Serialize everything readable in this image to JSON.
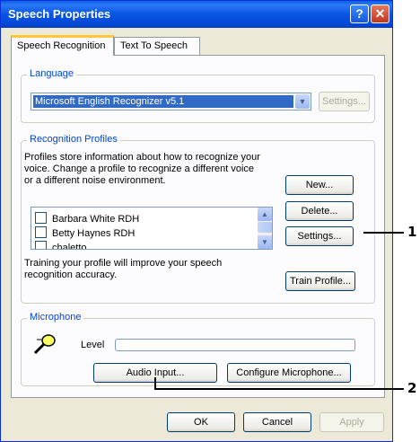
{
  "window": {
    "title": "Speech Properties",
    "help_glyph": "?",
    "close_glyph": "✕"
  },
  "tabs": [
    {
      "label": "Speech Recognition",
      "active": true
    },
    {
      "label": "Text To Speech",
      "active": false
    }
  ],
  "language": {
    "group_label": "Language",
    "selected_engine": "Microsoft English Recognizer v5.1",
    "settings_label": "Settings..."
  },
  "profiles": {
    "group_label": "Recognition Profiles",
    "description": [
      "Profiles store information about how to recognize your",
      "voice.  Change a profile to recognize a different voice",
      "or a different noise environment."
    ],
    "items": [
      {
        "label": "Barbara White RDH",
        "checked": false
      },
      {
        "label": "Betty Haynes RDH",
        "checked": false
      },
      {
        "label": "chaletto",
        "checked": false
      }
    ],
    "new_label": "New...",
    "delete_label": "Delete...",
    "settings_label": "Settings...",
    "training_text": [
      "Training your profile will improve your speech",
      "recognition accuracy."
    ],
    "train_label": "Train Profile..."
  },
  "microphone": {
    "group_label": "Microphone",
    "level_label": "Level",
    "audio_input_label": "Audio Input...",
    "configure_label": "Configure Microphone..."
  },
  "footer": {
    "ok_label": "OK",
    "cancel_label": "Cancel",
    "apply_label": "Apply"
  },
  "callouts": [
    {
      "number": "1"
    },
    {
      "number": "2"
    }
  ],
  "colors": {
    "titlebar": "#0755e3",
    "group_label": "#0046d5",
    "selection": "#316ac5",
    "tab_highlight": "#ffc83c"
  }
}
